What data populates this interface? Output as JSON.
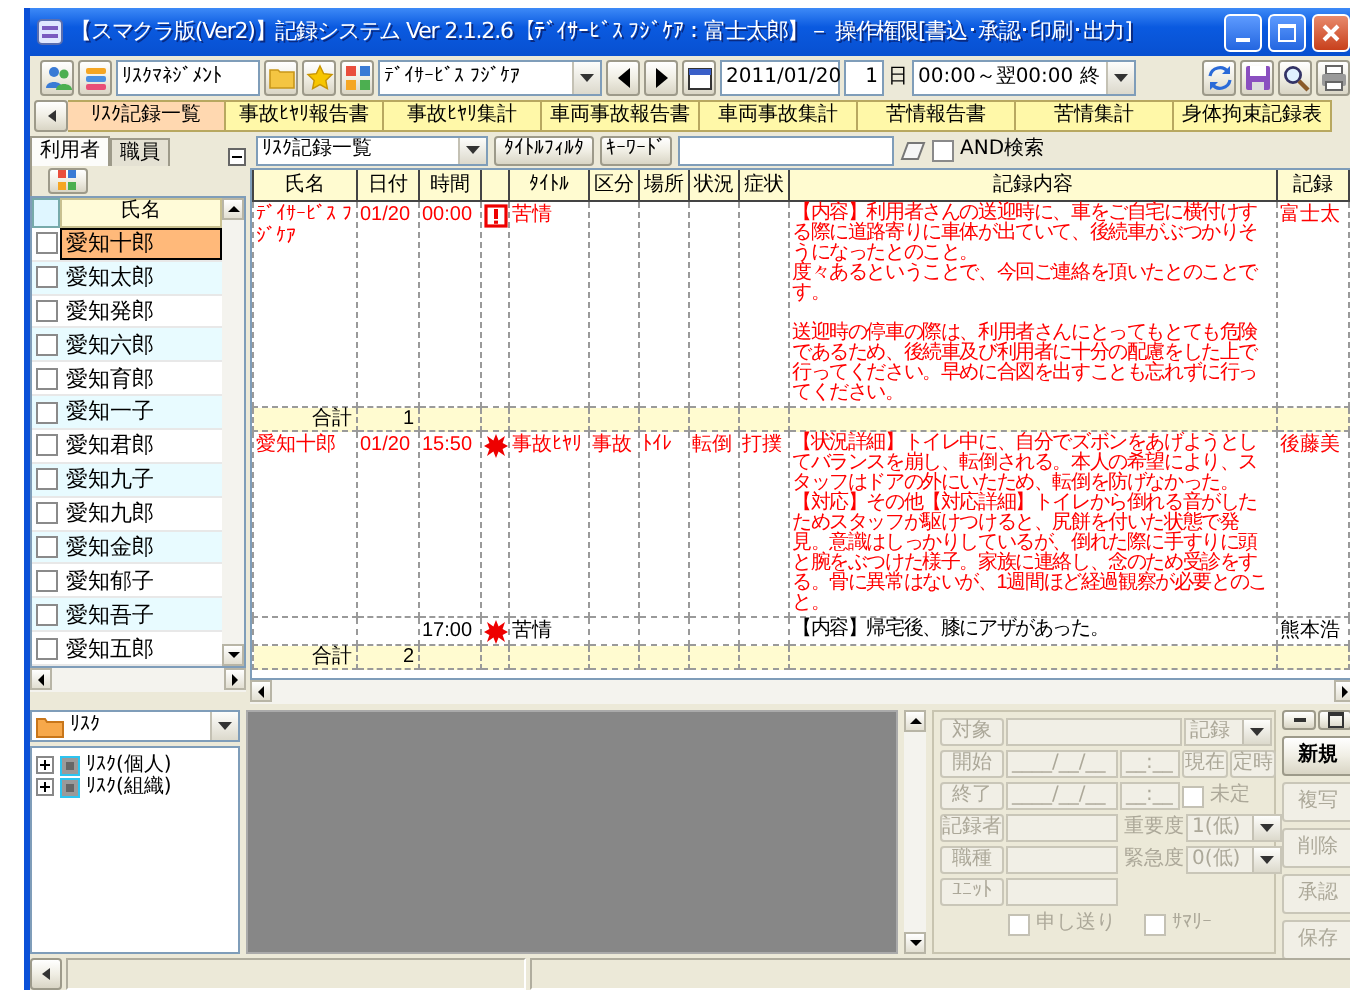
{
  "window": {
    "title": "【スマクラ版(Ver2)】記録システム Ver 2.1.2.6【ﾃﾞｲｻｰﾋﾞｽ ﾌｼﾞｹｱ：富士太郎】－ 操作権限[書込･承認･印刷･出力]"
  },
  "toolbar": {
    "group": "ﾘｽｸﾏﾈｼﾞﾒﾝﾄ",
    "facility": "ﾃﾞｲｻｰﾋﾞｽ ﾌｼﾞｹｱ",
    "date": "2011/01/20",
    "days": "1",
    "days_unit": "日",
    "time_range": "00:00～翌00:00 終"
  },
  "tabs": [
    {
      "label": "ﾘｽｸ記録一覧",
      "selected": true
    },
    {
      "label": "事故ﾋﾔﾘ報告書",
      "selected": false
    },
    {
      "label": "事故ﾋﾔﾘ集計",
      "selected": false
    },
    {
      "label": "車両事故報告書",
      "selected": false
    },
    {
      "label": "車両事故集計",
      "selected": false
    },
    {
      "label": "苦情報告書",
      "selected": false
    },
    {
      "label": "苦情集計",
      "selected": false
    },
    {
      "label": "身体拘束記録表",
      "selected": false
    }
  ],
  "left_panel": {
    "tabs": [
      {
        "label": "利用者",
        "selected": true
      },
      {
        "label": "職員",
        "selected": false
      }
    ],
    "column": "氏名",
    "residents": [
      {
        "name": "愛知十郎",
        "selected": true,
        "checked": false
      },
      {
        "name": "愛知太郎",
        "selected": false,
        "checked": false
      },
      {
        "name": "愛知発郎",
        "selected": false,
        "checked": false
      },
      {
        "name": "愛知六郎",
        "selected": false,
        "checked": false
      },
      {
        "name": "愛知育郎",
        "selected": false,
        "checked": false
      },
      {
        "name": "愛知一子",
        "selected": false,
        "checked": false
      },
      {
        "name": "愛知君郎",
        "selected": false,
        "checked": false
      },
      {
        "name": "愛知九子",
        "selected": false,
        "checked": false
      },
      {
        "name": "愛知九郎",
        "selected": false,
        "checked": false
      },
      {
        "name": "愛知金郎",
        "selected": false,
        "checked": false
      },
      {
        "name": "愛知郁子",
        "selected": false,
        "checked": false
      },
      {
        "name": "愛知吾子",
        "selected": false,
        "checked": false
      },
      {
        "name": "愛知五郎",
        "selected": false,
        "checked": false
      }
    ]
  },
  "record_list": {
    "view": "ﾘｽｸ記録一覧",
    "title_filter": "ﾀｲﾄﾙﾌｨﾙﾀ",
    "keyword": "ｷｰﾜｰﾄﾞ",
    "and_search": {
      "label": "AND検索",
      "checked": false
    }
  },
  "table": {
    "columns": [
      "氏名",
      "日付",
      "時間",
      "ﾀｲﾄﾙ",
      "区分",
      "場所",
      "状況",
      "症状",
      "記録内容",
      "記録"
    ],
    "rows": [
      {
        "kind": "alert",
        "flagged": true,
        "name": "ﾃﾞｲｻｰﾋﾞｽ ﾌｼﾞｹｱ",
        "date": "01/20",
        "time": "00:00",
        "title": "苦情",
        "content": [
          [
            "【内容】利用者さんの送迎時に、車をご自宅に横付けする際に道路寄りに車体が出ていて、後続車がぶつかりそうになったとのこと。",
            "度々あるということで、今回ご連絡を頂いたとのことです。"
          ],
          [
            "送迎時の停車の際は、利用者さんにとってもとても危険であるため、後続車及び利用者に十分の配慮をした上で行ってください。早めに合図を出すことも忘れずに行ってください。"
          ]
        ],
        "recorder": "富士太"
      },
      {
        "kind": "total",
        "label": "合計",
        "count": "1"
      },
      {
        "kind": "incident",
        "flagged": true,
        "name": "愛知十郎",
        "date": "01/20",
        "time": "15:50",
        "title": "事故ﾋﾔﾘ",
        "category": "事故",
        "place": "ﾄｲﾚ",
        "situation": "転倒",
        "symptom": "打撲",
        "content": [
          [
            "【状況詳細】トイレ中に、自分でズボンをあげようとしてバランスを崩し、転倒される。本人の希望により、スタッフはドアの外にいたため、転倒を防げなかった。【対応】その他【対応詳細】トイレから倒れる音がしたためスタッフが駆けつけると、尻餅を付いた状態で発見。意識はしっかりしているが、倒れた際に手すりに頭と腕をぶつけた様子。家族に連絡し、念のため受診をする。骨に異常はないが、1週間ほど経過観察が必要とのこと。"
          ]
        ],
        "recorder": "後藤美"
      },
      {
        "kind": "incident",
        "flagged": false,
        "time": "17:00",
        "title": "苦情",
        "content": [
          [
            "【内容】帰宅後、膝にアザがあった。"
          ]
        ],
        "recorder": "熊本浩"
      },
      {
        "kind": "total",
        "label": "合計",
        "count": "2"
      }
    ]
  },
  "tree": {
    "category": "ﾘｽｸ",
    "items": [
      {
        "label": "ﾘｽｸ(個人)",
        "expanded": false
      },
      {
        "label": "ﾘｽｸ(組織)",
        "expanded": false
      }
    ]
  },
  "record_form": {
    "disabled": true,
    "target": "対象",
    "record_type": "記録",
    "start": "開始",
    "start_date": "____/__/__",
    "start_time": "__:__",
    "now": "現在",
    "fixed": "定時",
    "end": "終了",
    "end_date": "____/__/__",
    "end_time": "__:__",
    "undecided": {
      "label": "未定",
      "checked": false
    },
    "recorder": "記録者",
    "importance_label": "重要度",
    "importance": "1(低)",
    "job": "職種",
    "urgency_label": "緊急度",
    "urgency": "0(低)",
    "unit": "ﾕﾆｯﾄ",
    "handover": {
      "label": "申し送り",
      "checked": false
    },
    "summary": {
      "label": "ｻﾏﾘｰ",
      "checked": false
    }
  },
  "actions": [
    {
      "label": "新規",
      "disabled": false
    },
    {
      "label": "複写",
      "disabled": true
    },
    {
      "label": "削除",
      "disabled": true
    },
    {
      "label": "承認",
      "disabled": true
    },
    {
      "label": "保存",
      "disabled": true
    }
  ]
}
